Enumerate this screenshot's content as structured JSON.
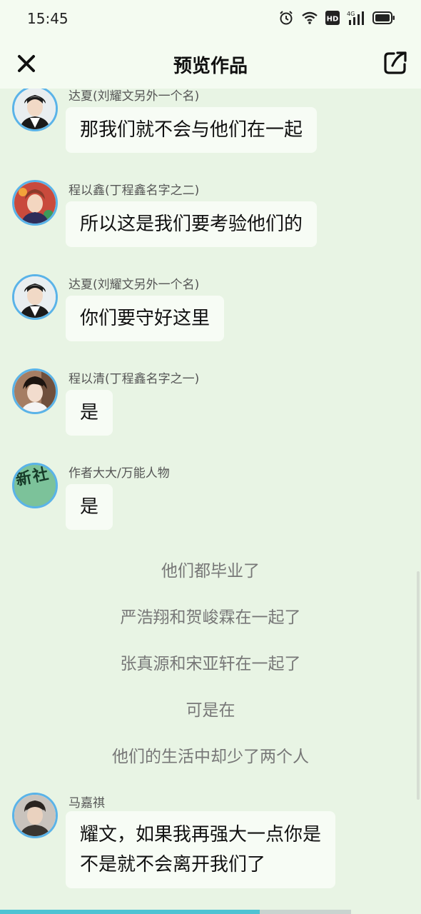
{
  "status_bar": {
    "time": "15:45",
    "icons": [
      "alarm-icon",
      "wifi-icon",
      "hd-icon",
      "4g-signal-icon",
      "battery-icon"
    ],
    "network_label": "4G",
    "hd_label": "HD"
  },
  "header": {
    "title": "预览作品",
    "close_icon": "close-icon",
    "share_icon": "share-icon"
  },
  "messages": [
    {
      "sender": "达夏(刘耀文另外一个名)",
      "text": "那我们就不会与他们在一起"
    },
    {
      "sender": "程以鑫(丁程鑫名字之二)",
      "text": "所以这是我们要考验他们的"
    },
    {
      "sender": "达夏(刘耀文另外一个名)",
      "text": "你们要守好这里"
    },
    {
      "sender": "程以清(丁程鑫名字之一)",
      "text": "是"
    },
    {
      "sender": "作者大大/万能人物",
      "text": "是",
      "avatar_text": "新社"
    },
    {
      "sender": "马嘉祺",
      "text_line1": "耀文，如果我再强大一点你是",
      "text_line2": "不是就不会离开我们了"
    }
  ],
  "narration": [
    "他们都毕业了",
    "严浩翔和贺峻霖在一起了",
    "张真源和宋亚轩在一起了",
    "可是在",
    "他们的生活中却少了两个人"
  ],
  "progress": {
    "fraction": 0.74
  },
  "colors": {
    "background": "#e8f4e4",
    "bubble": "#f7fcf5",
    "avatar_ring": "#5ab3e8",
    "progress": "#4ec3d3"
  }
}
